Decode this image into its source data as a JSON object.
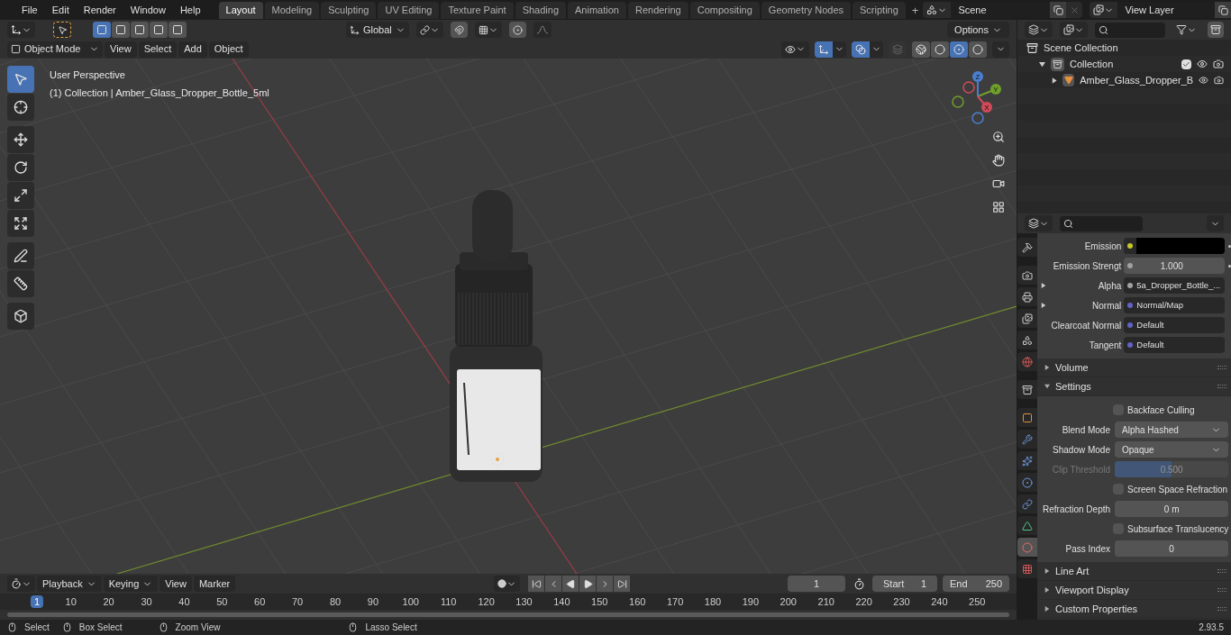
{
  "menu": [
    "File",
    "Edit",
    "Render",
    "Window",
    "Help"
  ],
  "workspaces": [
    {
      "label": "Layout",
      "selected": true
    },
    {
      "label": "Modeling",
      "selected": false
    },
    {
      "label": "Sculpting",
      "selected": false
    },
    {
      "label": "UV Editing",
      "selected": false
    },
    {
      "label": "Texture Paint",
      "selected": false
    },
    {
      "label": "Shading",
      "selected": false
    },
    {
      "label": "Animation",
      "selected": false
    },
    {
      "label": "Rendering",
      "selected": false
    },
    {
      "label": "Compositing",
      "selected": false
    },
    {
      "label": "Geometry Nodes",
      "selected": false
    },
    {
      "label": "Scripting",
      "selected": false
    }
  ],
  "add_workspace": "+",
  "scene": {
    "value": "Scene"
  },
  "view_layer": {
    "value": "View Layer"
  },
  "tool_header": {
    "select_modes": [
      {
        "selected": true
      },
      {
        "selected": false
      },
      {
        "selected": false
      },
      {
        "selected": false
      },
      {
        "selected": false
      }
    ],
    "transform_orientation": "Global",
    "options": "Options"
  },
  "viewport_header": {
    "mode": "Object Mode",
    "gizmos_on": true,
    "overlays_on": true,
    "menus": [
      "View",
      "Select",
      "Add",
      "Object"
    ],
    "shading_modes": [
      {
        "selected": false
      },
      {
        "selected": false
      },
      {
        "selected": true
      },
      {
        "selected": false
      }
    ]
  },
  "tools": [
    {
      "kind": "select",
      "selected": true
    },
    {
      "kind": "cursor",
      "selected": false
    },
    {
      "kind": "move",
      "selected": false
    },
    {
      "kind": "rotate",
      "selected": false
    },
    {
      "kind": "scale",
      "selected": false
    },
    {
      "kind": "transform",
      "selected": false
    },
    {
      "kind": "annotate",
      "selected": false
    },
    {
      "kind": "measure",
      "selected": false
    },
    {
      "kind": "add_cube",
      "selected": false
    }
  ],
  "viewport_overlay": [
    "User Perspective",
    "(1) Collection | Amber_Glass_Dropper_Bottle_5ml"
  ],
  "gizmo_axes": [
    "Y",
    "X",
    "Z"
  ],
  "outliner": [
    {
      "label": "Scene Collection",
      "kind": "scene",
      "children": [
        {
          "label": "Collection",
          "kind": "collection",
          "expanded": true,
          "checked": true,
          "children": [
            {
              "label": "Amber_Glass_Dropper_B",
              "kind": "object",
              "expanded": false
            }
          ]
        }
      ]
    }
  ],
  "property_tabs": [
    {
      "kind": "tool",
      "selected": false
    },
    {
      "kind": "render",
      "selected": false
    },
    {
      "kind": "output",
      "selected": false
    },
    {
      "kind": "view_layer",
      "selected": false
    },
    {
      "kind": "scene",
      "selected": false
    },
    {
      "kind": "world",
      "selected": false
    },
    {
      "kind": "collection",
      "selected": false
    },
    {
      "kind": "object",
      "selected": false
    },
    {
      "kind": "modifier",
      "selected": false
    },
    {
      "kind": "particles",
      "selected": false
    },
    {
      "kind": "physics",
      "selected": false
    },
    {
      "kind": "constraints",
      "selected": false
    },
    {
      "kind": "data",
      "selected": false
    },
    {
      "kind": "material",
      "selected": true
    },
    {
      "kind": "texture",
      "selected": false
    }
  ],
  "sockets": [
    {
      "label": "Emission",
      "kind": "color",
      "color": "#c7c729",
      "expandable": false,
      "animatable": true
    },
    {
      "label": "Emission Strengt",
      "kind": "number",
      "color": "#a1a1a1",
      "value": "1.000",
      "expandable": false,
      "animatable": true
    },
    {
      "label": "Alpha",
      "kind": "link",
      "color": "#a1a1a1",
      "value": "5a_Dropper_Bottle_...",
      "expandable": true,
      "animatable": false
    },
    {
      "label": "Normal",
      "kind": "link",
      "color": "#6363c7",
      "value": "Normal/Map",
      "expandable": true,
      "animatable": false
    },
    {
      "label": "Clearcoat Normal",
      "kind": "link",
      "color": "#6363c7",
      "value": "Default",
      "expandable": false,
      "animatable": false
    },
    {
      "label": "Tangent",
      "kind": "link",
      "color": "#6363c7",
      "value": "Default",
      "expandable": false,
      "animatable": false
    }
  ],
  "panels": [
    {
      "title": "Volume",
      "expanded": false
    },
    {
      "title": "Settings",
      "expanded": true,
      "fields": [
        {
          "kind": "checkbox",
          "label": "Backface Culling",
          "checked": false
        },
        {
          "kind": "select",
          "label": "Blend Mode",
          "value": "Alpha Hashed"
        },
        {
          "kind": "select",
          "label": "Shadow Mode",
          "value": "Opaque"
        },
        {
          "kind": "slider",
          "label": "Clip Threshold",
          "value": "0.500",
          "level": 0.5,
          "disabled": true
        },
        {
          "kind": "checkbox",
          "label": "Screen Space Refraction",
          "checked": false
        },
        {
          "kind": "number",
          "label": "Refraction Depth",
          "value": "0 m"
        },
        {
          "kind": "checkbox",
          "label": "Subsurface Translucency",
          "checked": false
        },
        {
          "kind": "number",
          "label": "Pass Index",
          "value": "0"
        }
      ]
    },
    {
      "title": "Line Art",
      "expanded": false
    },
    {
      "title": "Viewport Display",
      "expanded": false
    },
    {
      "title": "Custom Properties",
      "expanded": false
    }
  ],
  "timeline": {
    "menus": [
      "Playback",
      "Keying",
      "View",
      "Marker"
    ],
    "current_frame": "1",
    "start_label": "Start",
    "start": "1",
    "end_label": "End",
    "end": "250",
    "ticks": [
      {
        "label": "1",
        "selected": true
      },
      {
        "label": "10",
        "selected": false
      },
      {
        "label": "20",
        "selected": false
      },
      {
        "label": "30",
        "selected": false
      },
      {
        "label": "40",
        "selected": false
      },
      {
        "label": "50",
        "selected": false
      },
      {
        "label": "60",
        "selected": false
      },
      {
        "label": "70",
        "selected": false
      },
      {
        "label": "80",
        "selected": false
      },
      {
        "label": "90",
        "selected": false
      },
      {
        "label": "100",
        "selected": false
      },
      {
        "label": "110",
        "selected": false
      },
      {
        "label": "120",
        "selected": false
      },
      {
        "label": "130",
        "selected": false
      },
      {
        "label": "140",
        "selected": false
      },
      {
        "label": "150",
        "selected": false
      },
      {
        "label": "160",
        "selected": false
      },
      {
        "label": "170",
        "selected": false
      },
      {
        "label": "180",
        "selected": false
      },
      {
        "label": "190",
        "selected": false
      },
      {
        "label": "200",
        "selected": false
      },
      {
        "label": "210",
        "selected": false
      },
      {
        "label": "220",
        "selected": false
      },
      {
        "label": "230",
        "selected": false
      },
      {
        "label": "240",
        "selected": false
      },
      {
        "label": "250",
        "selected": false
      }
    ]
  },
  "status_bar": {
    "hints": [
      "Select",
      "Box Select",
      "Zoom View",
      "Lasso Select"
    ],
    "version": "2.93.5"
  }
}
